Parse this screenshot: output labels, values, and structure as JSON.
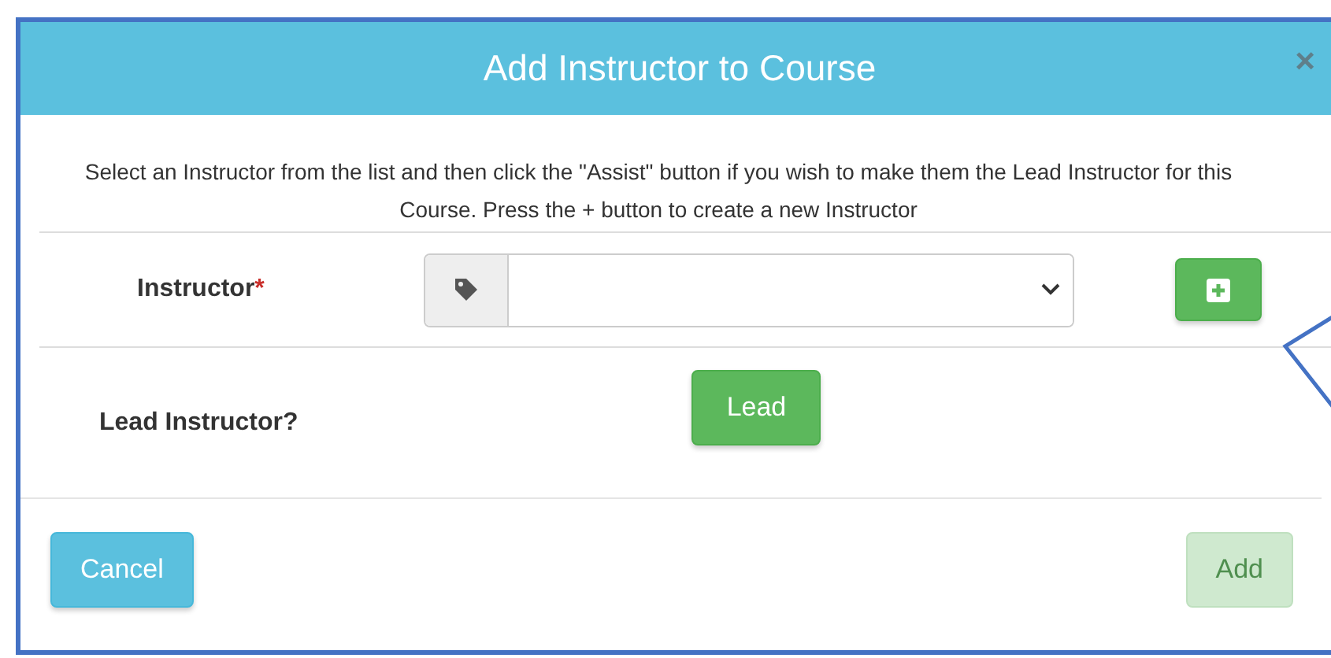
{
  "dialog": {
    "title": "Add Instructor to Course",
    "close": "×"
  },
  "description": "Select an Instructor from the list and then click the \"Assist\" button if you wish to make them the Lead Instructor for this Course. Press the + button to create a new Instructor",
  "instructor_field": {
    "label": "Instructor",
    "required": true,
    "required_mark": "*"
  },
  "lead_field": {
    "label": "Lead Instructor?",
    "button": "Lead"
  },
  "footer": {
    "cancel": "Cancel",
    "add": {
      "label": "Add",
      "disabled": true
    }
  }
}
